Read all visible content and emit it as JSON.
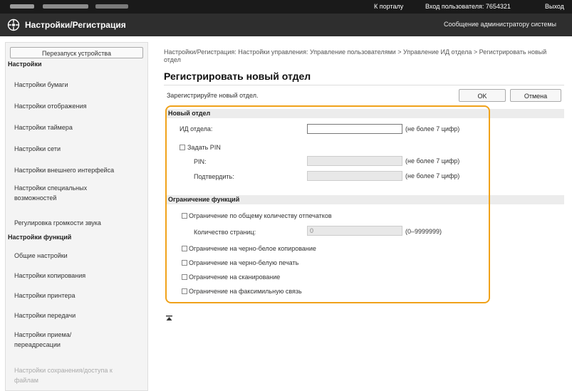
{
  "topbar": {
    "portal_link": "К порталу",
    "login_text": "Вход пользователя: 7654321",
    "logout_link": "Выход"
  },
  "header": {
    "title": "Настройки/Регистрация",
    "admin_message": "Сообщение администратору системы"
  },
  "sidebar": {
    "reboot_button": "Перезапуск устройства",
    "settings_header": "Настройки",
    "settings_items": [
      "Настройки бумаги",
      "Настройки отображения",
      "Настройки таймера",
      "Настройки сети",
      "Настройки внешнего интерфейса",
      "Настройки специальных возможностей",
      "Регулировка громкости звука"
    ],
    "functions_header": "Настройки функций",
    "functions_items": [
      "Общие настройки",
      "Настройки копирования",
      "Настройки принтера",
      "Настройки передачи",
      "Настройки приема/переадресации",
      "Настройки сохранения/доступа к файлам"
    ]
  },
  "main": {
    "breadcrumb": "Настройки/Регистрация: Настройки управления: Управление пользователями > Управление ИД отдела > Регистрировать новый отдел",
    "title": "Регистрировать новый отдел",
    "instruction": "Зарегистрируйте новый отдел.",
    "ok_button": "OK",
    "cancel_button": "Отмена",
    "new_dept": {
      "section_title": "Новый отдел",
      "dept_id_label": "ИД отдела:",
      "dept_id_value": "",
      "dept_id_hint": "(не более 7 цифр)",
      "set_pin_label": "Задать PIN",
      "pin_label": "PIN:",
      "pin_hint": "(не более 7 цифр)",
      "confirm_label": "Подтвердить:",
      "confirm_hint": "(не более 7 цифр)"
    },
    "restrictions": {
      "section_title": "Ограничение функций",
      "total_prints_label": "Ограничение по общему количеству отпечатков",
      "pages_label": "Количество страниц:",
      "pages_value": "0",
      "pages_hint": "(0–9999999)",
      "bw_copy_label": "Ограничение на черно-белое копирование",
      "bw_print_label": "Ограничение на черно-белую печать",
      "scan_label": "Ограничение на сканирование",
      "fax_label": "Ограничение на факсимильную связь"
    }
  }
}
